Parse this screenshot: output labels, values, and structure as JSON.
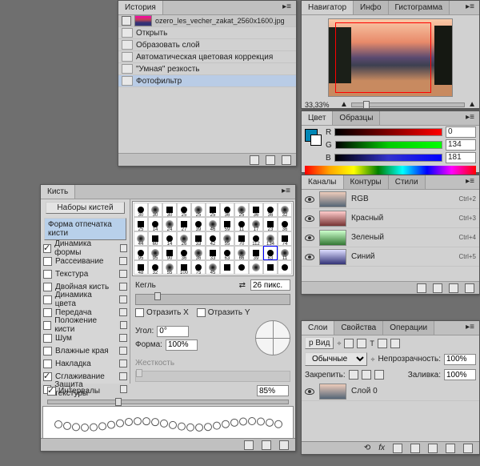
{
  "history": {
    "tab": "История",
    "file": "ozero_les_vecher_zakat_2560x1600.jpg",
    "items": [
      "Открыть",
      "Образовать слой",
      "Автоматическая цветовая коррекция",
      "\"Умная\" резкость",
      "Фотофильтр"
    ],
    "selected": 4
  },
  "navigator": {
    "tabs": [
      "Навигатор",
      "Инфо",
      "Гистограмма"
    ],
    "zoom": "33,33%"
  },
  "color": {
    "tabs": [
      "Цвет",
      "Образцы"
    ],
    "r_label": "R",
    "g_label": "G",
    "b_label": "B",
    "r": "0",
    "g": "134",
    "b": "181"
  },
  "channels": {
    "tabs": [
      "Каналы",
      "Контуры",
      "Стили"
    ],
    "rows": [
      {
        "name": "RGB",
        "sc": "Ctrl+2"
      },
      {
        "name": "Красный",
        "sc": "Ctrl+3"
      },
      {
        "name": "Зеленый",
        "sc": "Ctrl+4"
      },
      {
        "name": "Синий",
        "sc": "Ctrl+5"
      }
    ]
  },
  "layers": {
    "tabs": [
      "Слои",
      "Свойства",
      "Операции"
    ],
    "kind_label": "р Вид",
    "opacity_label": "Непрозрачность:",
    "opacity": "100%",
    "blend": "Обычные",
    "lock_label": "Закрепить:",
    "fill_label": "Заливка:",
    "fill": "100%",
    "layer0": "Слой 0"
  },
  "brush": {
    "tab": "Кисть",
    "presets_btn": "Наборы кистей",
    "shape_btn": "Форма отпечатка кисти",
    "options": [
      {
        "l": "Динамика формы",
        "c": true
      },
      {
        "l": "Рассеивание",
        "c": false
      },
      {
        "l": "Текстура",
        "c": false
      },
      {
        "l": "Двойная кисть",
        "c": false
      },
      {
        "l": "Динамика цвета",
        "c": false
      },
      {
        "l": "Передача",
        "c": false
      },
      {
        "l": "Положение кисти",
        "c": false
      },
      {
        "l": "Шум",
        "c": false
      },
      {
        "l": "Влажные края",
        "c": false
      },
      {
        "l": "Накладка",
        "c": false
      },
      {
        "l": "Сглаживание",
        "c": true
      },
      {
        "l": "Защита текстуры",
        "c": false
      }
    ],
    "size_label": "Кегль",
    "size": "26 пикс.",
    "flipx": "Отразить X",
    "flipy": "Отразить Y",
    "angle_label": "Угол:",
    "angle": "0°",
    "form_label": "Форма:",
    "form": "100%",
    "hardness_label": "Жесткость",
    "spacing_label": "Интервалы",
    "spacing": "85%",
    "grid_labels": [
      "30",
      "30",
      "30",
      "25",
      "25",
      "25",
      "36",
      "25",
      "36",
      "36",
      "32",
      "25",
      "14",
      "24",
      "27",
      "39",
      "46",
      "59",
      "11",
      "17",
      "23",
      "36",
      "44",
      "60",
      "14",
      "26",
      "33",
      "42",
      "55",
      "70",
      "112",
      "134",
      "74",
      "95",
      "95",
      "90",
      "36",
      "36",
      "33",
      "63",
      "66",
      "39",
      "63",
      "11",
      "48",
      "32",
      "55",
      "100",
      "75",
      "45"
    ]
  }
}
